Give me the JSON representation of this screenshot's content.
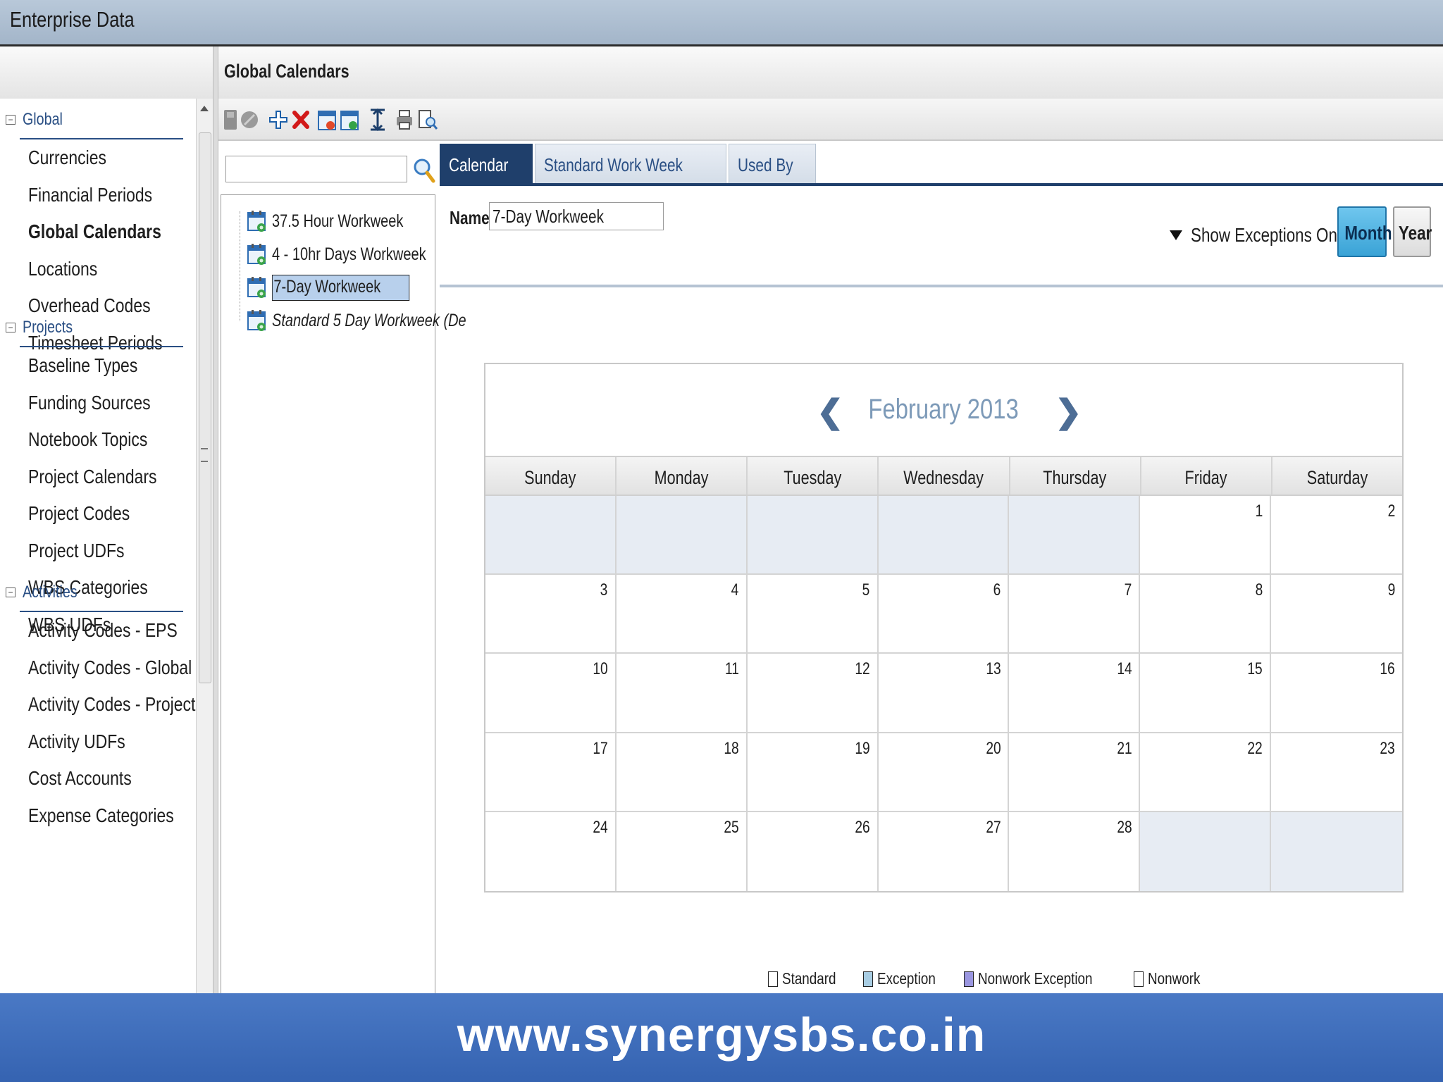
{
  "window": {
    "title": "Enterprise Data"
  },
  "sidebar": {
    "groups": [
      {
        "label": "Global",
        "items": [
          "Currencies",
          "Financial Periods",
          "Global Calendars",
          "Locations",
          "Overhead Codes",
          "Timesheet Periods"
        ]
      },
      {
        "label": "Projects",
        "items": [
          "Baseline Types",
          "Funding Sources",
          "Notebook Topics",
          "Project Calendars",
          "Project Codes",
          "Project UDFs",
          "WBS Categories",
          "WBS UDFs"
        ]
      },
      {
        "label": "Activities",
        "items": [
          "Activity Codes - EPS",
          "Activity Codes - Global",
          "Activity Codes - Project",
          "Activity UDFs",
          "Cost Accounts",
          "Expense Categories"
        ]
      }
    ],
    "active_item": "Global Calendars"
  },
  "panel": {
    "title": "Global Calendars"
  },
  "toolbar": {
    "icons": [
      "save-icon",
      "cancel-icon",
      "add-icon",
      "delete-icon",
      "calendar-add-icon",
      "calendar-copy-icon",
      "expand-icon",
      "print-icon",
      "print-preview-icon"
    ]
  },
  "search": {
    "value": "",
    "placeholder": ""
  },
  "calendar_list": [
    {
      "label": "37.5 Hour Workweek",
      "selected": false,
      "italic": false
    },
    {
      "label": "4 - 10hr Days Workweek",
      "selected": false,
      "italic": false
    },
    {
      "label": "7-Day Workweek",
      "selected": true,
      "italic": false
    },
    {
      "label": "Standard 5 Day Workweek (De",
      "selected": false,
      "italic": true
    }
  ],
  "tabs": [
    {
      "label": "Calendar",
      "active": true
    },
    {
      "label": "Standard Work Week",
      "active": false
    },
    {
      "label": "Used By",
      "active": false
    }
  ],
  "detail": {
    "name_label": "Name",
    "name_value": "7-Day Workweek",
    "show_exceptions_label": "Show Exceptions Only",
    "view_buttons": {
      "month": "Month",
      "year": "Year",
      "selected": "Month"
    }
  },
  "month_view": {
    "title": "February 2013",
    "weekdays": [
      "Sunday",
      "Monday",
      "Tuesday",
      "Wednesday",
      "Thursday",
      "Friday",
      "Saturday"
    ],
    "days": [
      "",
      "",
      "",
      "",
      "",
      "1",
      "2",
      "3",
      "4",
      "5",
      "6",
      "7",
      "8",
      "9",
      "10",
      "11",
      "12",
      "13",
      "14",
      "15",
      "16",
      "17",
      "18",
      "19",
      "20",
      "21",
      "22",
      "23",
      "24",
      "25",
      "26",
      "27",
      "28",
      "",
      ""
    ]
  },
  "legend": [
    {
      "label": "Standard",
      "color": "#ffffff"
    },
    {
      "label": "Exception",
      "color": "#a8cde3"
    },
    {
      "label": "Nonwork Exception",
      "color": "#9a96e0"
    },
    {
      "label": "Nonwork",
      "color": "#ffffff"
    }
  ],
  "footer": {
    "text": "www.synergysbs.co.in"
  },
  "colors": {
    "accent": "#1f3f6b",
    "footer_bg": "#3f6fbe",
    "selection": "#b8d0ec"
  }
}
